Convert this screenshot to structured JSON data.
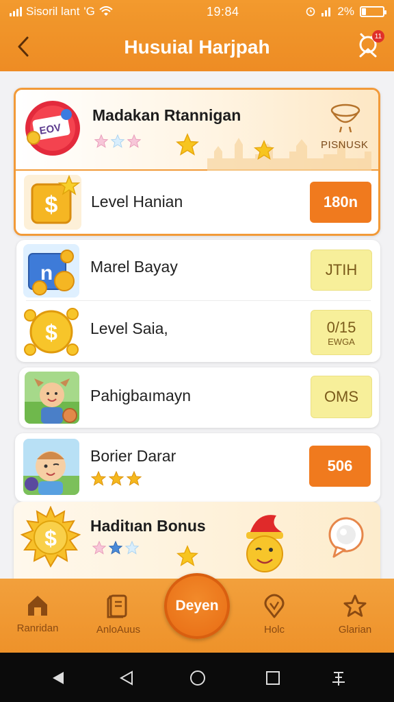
{
  "status_bar": {
    "carrier": "Sisoril lant",
    "carrier_suffix": "'G",
    "time": "19:84",
    "battery_percent": "2%"
  },
  "header": {
    "title": "Husuial Harjpah",
    "notification_count": "11"
  },
  "featured": {
    "title": "Madakan Rtannigan",
    "badge_text": "PISNUSK",
    "logo_text": "ΕΟV",
    "star_rating": 0,
    "level_label": "Level Hanian",
    "level_value": "180n"
  },
  "items": [
    {
      "label": "Marel Bayay",
      "value": "JTIH",
      "sub": "",
      "style": "yellow"
    },
    {
      "label": "Level Saia,",
      "value": "0/15",
      "sub": "EWGA",
      "style": "yellow"
    },
    {
      "label": "Pahigbaımayn",
      "value": "OMS",
      "sub": "",
      "style": "yellow"
    }
  ],
  "reward_card": {
    "label": "Borier Darar",
    "value": "506",
    "star_rating": 3
  },
  "bonus_card": {
    "label": "Haditıan Bonus",
    "star_rating": 1
  },
  "bottom_nav": {
    "items": [
      {
        "label": "Ranridan",
        "icon": "home-icon"
      },
      {
        "label": "AnloAuus",
        "icon": "book-icon"
      },
      {
        "label": "Holc",
        "icon": "location-icon"
      },
      {
        "label": "Glarian",
        "icon": "star-icon"
      }
    ],
    "center_label": "Deyen"
  },
  "colors": {
    "primary_orange": "#f0952a",
    "accent_orange": "#f07a1e",
    "pill_yellow": "#f7ef9a",
    "star_gold": "#f5b81e"
  }
}
